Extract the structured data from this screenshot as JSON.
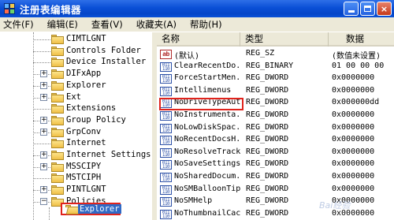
{
  "window": {
    "title": "注册表编辑器",
    "min_label": "",
    "max_label": "",
    "close_label": "×"
  },
  "menu": [
    "文件(F)",
    "编辑(E)",
    "查看(V)",
    "收藏夹(A)",
    "帮助(H)"
  ],
  "tree": {
    "items": [
      {
        "label": "CIMTLGNT",
        "expander": ""
      },
      {
        "label": "Controls Folder",
        "expander": ""
      },
      {
        "label": "Device Installer",
        "expander": ""
      },
      {
        "label": "DIFxApp",
        "expander": "+"
      },
      {
        "label": "Explorer",
        "expander": "+"
      },
      {
        "label": "Ext",
        "expander": "+"
      },
      {
        "label": "Extensions",
        "expander": ""
      },
      {
        "label": "Group Policy",
        "expander": "+"
      },
      {
        "label": "GrpConv",
        "expander": "+"
      },
      {
        "label": "Internet",
        "expander": ""
      },
      {
        "label": "Internet Settings",
        "expander": "+"
      },
      {
        "label": "MSSCIPY",
        "expander": "+"
      },
      {
        "label": "MSTCIPH",
        "expander": ""
      },
      {
        "label": "PINTLGNT",
        "expander": "+"
      },
      {
        "label": "Policies",
        "expander": "−"
      }
    ],
    "selected_label": "Explorer"
  },
  "list": {
    "columns": {
      "name": "名称",
      "type": "类型",
      "data": "数据"
    },
    "rows": [
      {
        "name": "(默认)",
        "type": "REG_SZ",
        "data": "(数值未设置)",
        "icon": "sz"
      },
      {
        "name": "ClearRecentDo...",
        "type": "REG_BINARY",
        "data": "01 00 00 00",
        "icon": "bin"
      },
      {
        "name": "ForceStartMen...",
        "type": "REG_DWORD",
        "data": "0x0000000",
        "icon": "bin"
      },
      {
        "name": "Intellimenus",
        "type": "REG_DWORD",
        "data": "0x0000000",
        "icon": "bin"
      },
      {
        "name": "NoDriveTypeAutoRun",
        "type": "REG_DWORD",
        "data": "0x000000dd",
        "icon": "bin"
      },
      {
        "name": "NoInstrumenta...",
        "type": "REG_DWORD",
        "data": "0x0000000",
        "icon": "bin"
      },
      {
        "name": "NoLowDiskSpac...",
        "type": "REG_DWORD",
        "data": "0x0000000",
        "icon": "bin"
      },
      {
        "name": "NoRecentDocsH...",
        "type": "REG_DWORD",
        "data": "0x0000000",
        "icon": "bin"
      },
      {
        "name": "NoResolveTrack",
        "type": "REG_DWORD",
        "data": "0x0000000",
        "icon": "bin"
      },
      {
        "name": "NoSaveSettings",
        "type": "REG_DWORD",
        "data": "0x0000000",
        "icon": "bin"
      },
      {
        "name": "NoSharedDocum...",
        "type": "REG_DWORD",
        "data": "0x0000000",
        "icon": "bin"
      },
      {
        "name": "NoSMBalloonTip",
        "type": "REG_DWORD",
        "data": "0x0000000",
        "icon": "bin"
      },
      {
        "name": "NoSMHelp",
        "type": "REG_DWORD",
        "data": "0x0000000",
        "icon": "bin"
      },
      {
        "name": "NoThumbnailCache",
        "type": "REG_DWORD",
        "data": "0x0000000",
        "icon": "bin"
      }
    ]
  },
  "icons": {
    "app": "registry-cubes-icon",
    "folder": "folder-icon",
    "value_sz": "ab-string-icon",
    "value_bin": "binary-value-icon"
  },
  "colors": {
    "titlebar": "#0A4FD6",
    "selection": "#316AC5",
    "highlight_box": "#E0231C"
  }
}
